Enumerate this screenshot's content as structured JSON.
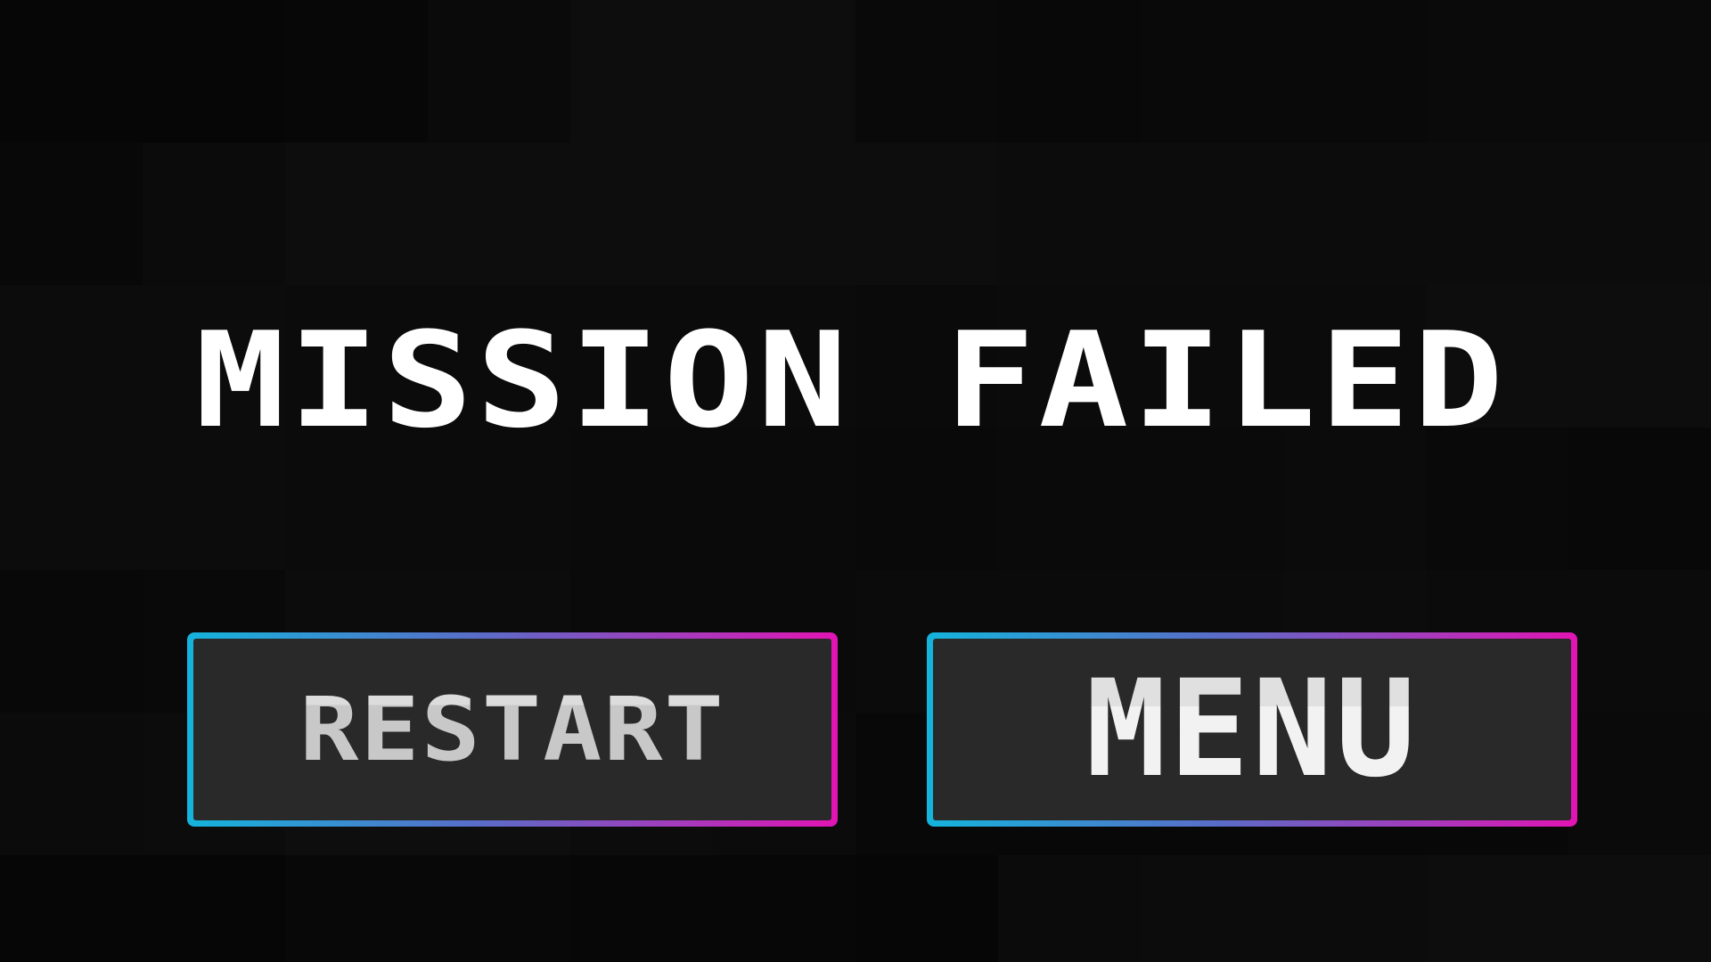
{
  "screen": {
    "title": "MISSION FAILED",
    "buttons": {
      "restart_label": "RESTART",
      "menu_label": "MENU"
    }
  },
  "colors": {
    "background": "#0b0b0b",
    "title_text": "#ffffff",
    "button_fill": "#292929",
    "button_border_start": "#14b4dc",
    "button_border_end": "#e214b4",
    "button_text": "#e8e8e8"
  },
  "background_tiles": [
    "#060606",
    "#060606",
    "#070707",
    "#0a0a0a",
    "#0d0d0d",
    "#0d0d0d",
    "#090909",
    "#080808",
    "#090909",
    "#090909",
    "#0a0a0a",
    "#0a0a0a",
    "#080808",
    "#0b0b0b",
    "#0d0d0d",
    "#0d0d0d",
    "#0d0d0d",
    "#0d0d0d",
    "#0d0d0d",
    "#0c0c0c",
    "#0c0c0c",
    "#0c0c0c",
    "#0c0c0c",
    "#0c0c0c",
    "#0c0c0c",
    "#0c0c0c",
    "#0b0b0b",
    "#0b0b0b",
    "#0b0b0b",
    "#0b0b0b",
    "#0a0a0a",
    "#0b0b0b",
    "#0b0b0b",
    "#0b0b0b",
    "#0d0d0d",
    "#0d0d0d",
    "#0c0c0c",
    "#0c0c0c",
    "#0b0b0b",
    "#0b0b0b",
    "#0a0a0a",
    "#0a0a0a",
    "#090909",
    "#0a0a0a",
    "#0a0a0a",
    "#0b0b0b",
    "#090909",
    "#080808",
    "#080808",
    "#090909",
    "#0c0c0c",
    "#0c0c0c",
    "#0a0a0a",
    "#0a0a0a",
    "#0b0b0b",
    "#0b0b0b",
    "#0b0b0b",
    "#0c0c0c",
    "#0b0b0b",
    "#0b0b0b",
    "#0b0b0b",
    "#0c0c0c",
    "#0e0e0e",
    "#0e0e0e",
    "#0c0c0c",
    "#0b0b0b",
    "#080808",
    "#080808",
    "#080808",
    "#080808",
    "#080808",
    "#0a0a0a",
    "#060606",
    "#060606",
    "#080808",
    "#080808",
    "#070707",
    "#070707",
    "#060606",
    "#0b0b0b",
    "#0c0c0c",
    "#0c0c0c",
    "#0d0d0d",
    "#0d0d0d"
  ]
}
